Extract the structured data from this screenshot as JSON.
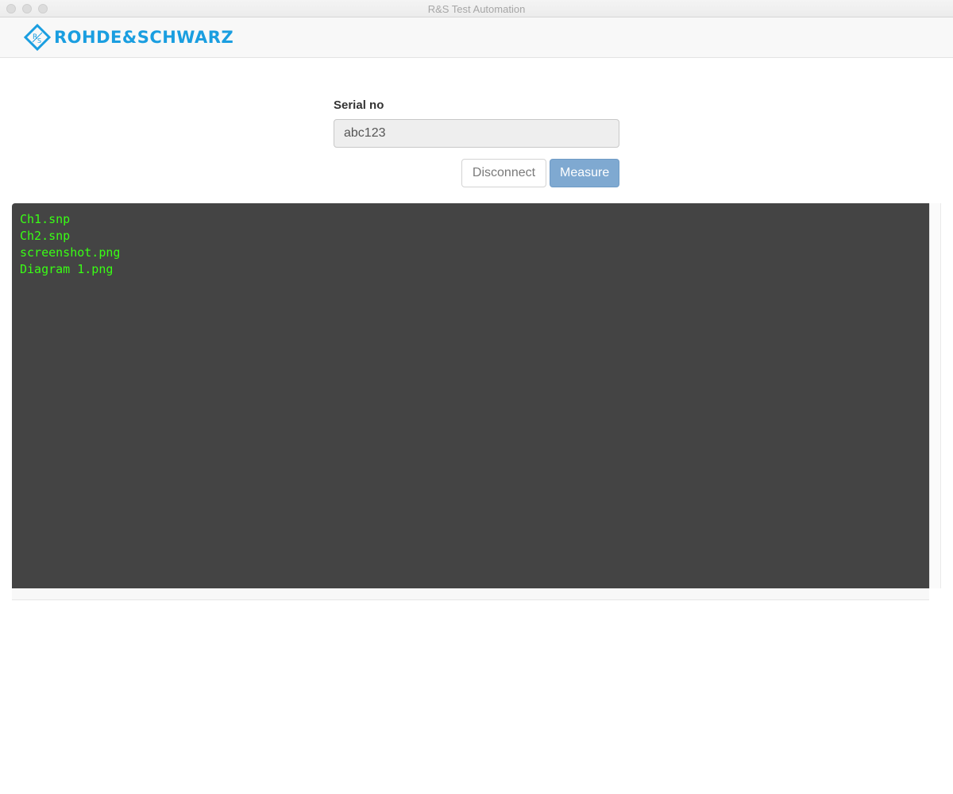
{
  "window": {
    "title": "R&S Test Automation"
  },
  "brand": {
    "name": "ROHDE&SCHWARZ",
    "color": "#1a9ee0"
  },
  "form": {
    "serial_label": "Serial no",
    "serial_value": "abc123"
  },
  "actions": {
    "disconnect_label": "Disconnect",
    "measure_label": "Measure"
  },
  "console": {
    "lines": [
      "Ch1.snp",
      "Ch2.snp",
      "screenshot.png",
      "Diagram 1.png"
    ],
    "text_color": "#39ff14",
    "background": "#444444"
  }
}
